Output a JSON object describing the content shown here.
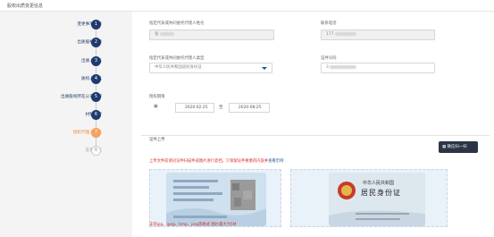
{
  "page_title": "股权出质变更信息",
  "steps": [
    {
      "num": "1",
      "label": "变更事项选择",
      "state": "done"
    },
    {
      "num": "2",
      "label": "出质股权数额",
      "state": "done"
    },
    {
      "num": "3",
      "label": "出质人姓名",
      "state": "done"
    },
    {
      "num": "4",
      "label": "质权人姓名",
      "state": "done"
    },
    {
      "num": "5",
      "label": "出质股权所在公司名称",
      "state": "done"
    },
    {
      "num": "6",
      "label": "材料上传",
      "state": "done"
    },
    {
      "num": "7",
      "label": "授权代理人信息",
      "state": "active"
    },
    {
      "num": "8",
      "label": "实名认证",
      "state": "pending"
    }
  ],
  "form": {
    "agent_name_label": "指定代表或共同委托代理人姓名",
    "agent_name_value": "张",
    "phone_label": "联系电话",
    "phone_value": "177",
    "cert_type_label": "指定代表或共同委托代理人类型",
    "cert_type_value": "中华人民共和国居民身份证",
    "cert_no_label": "证件号码",
    "cert_no_value": "3",
    "period_label": "授权期限",
    "date_start": "2020-02-25",
    "date_sep": "至",
    "date_end": "2020-08-25"
  },
  "upload": {
    "section_label": "证件上传",
    "wechat_button": "微信扫一扫",
    "warning_text": "上传文件前请对证件扫描件或图片进行遮挡，只保留证件要素的内容并",
    "warning_link": "查看示例",
    "footer_note": "支持jpg、jpeg、bmp、png等格式 图片最大为5M",
    "back_title": "中华人民共和国",
    "back_subtitle": "居民身份证"
  },
  "colors": {
    "primary": "#1f3a6e",
    "active": "#f5a260",
    "warning": "#d93025",
    "card_bg": "#e9f1f9"
  }
}
